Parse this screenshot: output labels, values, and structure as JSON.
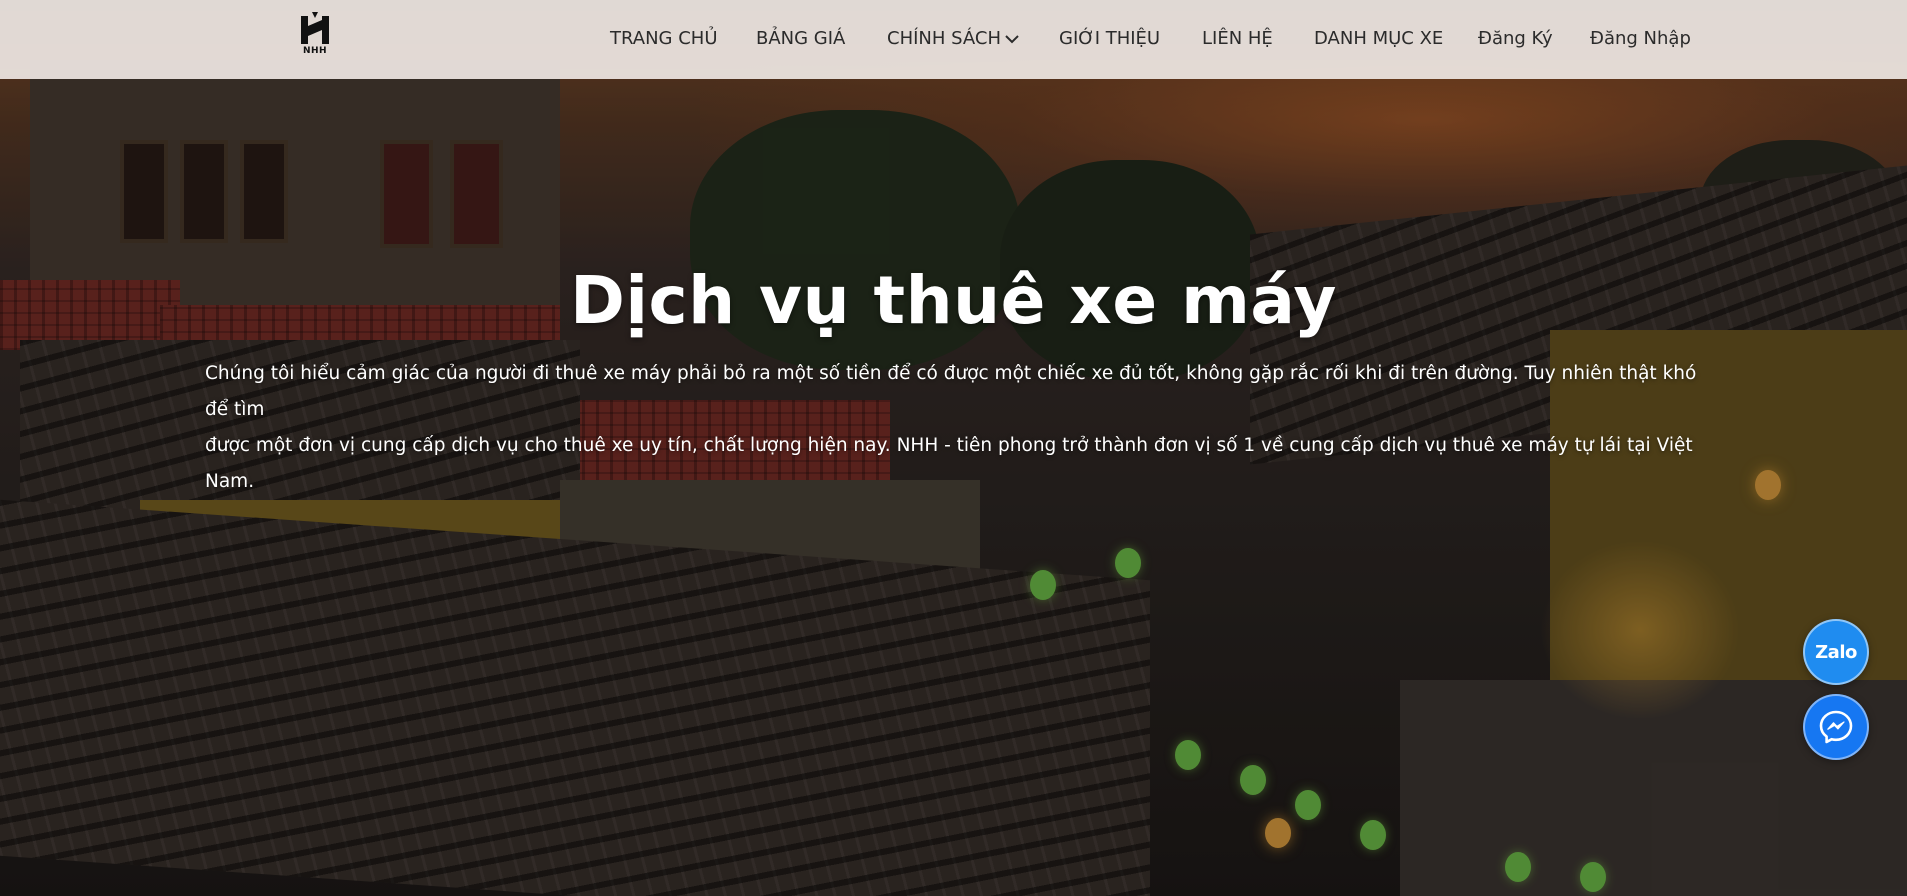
{
  "brand": {
    "logo_text": "NHH",
    "logo_icon": "nhh-logo-icon"
  },
  "nav": {
    "items": [
      {
        "label": "TRANG CHỦ"
      },
      {
        "label": "BẢNG GIÁ"
      },
      {
        "label": "CHÍNH SÁCH",
        "icon": "chevron-down-icon"
      },
      {
        "label": "GIỚI THIỆU"
      },
      {
        "label": "LIÊN HỆ"
      },
      {
        "label": "DANH MỤC XE"
      },
      {
        "label": "Đăng Ký"
      },
      {
        "label": "Đăng Nhập"
      }
    ]
  },
  "hero": {
    "title": "Dịch vụ thuê xe máy",
    "description_line1": "Chúng tôi hiểu cảm giác của người đi thuê xe máy phải bỏ ra một số tiền để có được một chiếc xe đủ tốt, không gặp rắc rối khi đi trên đường. Tuy nhiên thật khó để tìm",
    "description_line2": "được một đơn vị cung cấp dịch vụ cho thuê xe uy tín, chất lượng hiện nay. NHH - tiên phong trở thành đơn vị số 1 về cung cấp dịch vụ thuê xe máy tự lái tại Việt Nam."
  },
  "floating": {
    "zalo_label": "Zalo",
    "zalo_icon": "zalo-chat-icon",
    "messenger_icon": "messenger-icon"
  },
  "colors": {
    "navbar_bg": "#ece4e0",
    "nav_text": "#2b2b2b",
    "zalo_blue": "#1f8cf0",
    "messenger_blue": "#1677f2"
  }
}
